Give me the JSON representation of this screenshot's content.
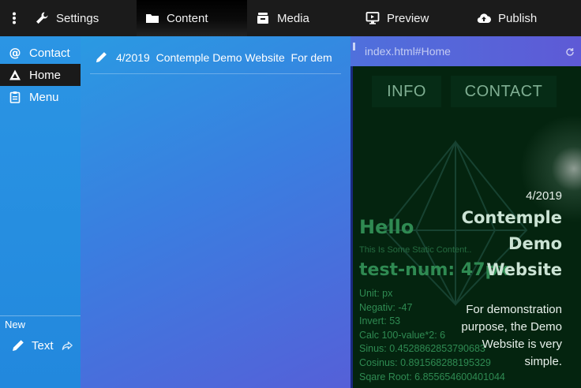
{
  "topbar": {
    "items": [
      {
        "label": "Settings",
        "icon": "wrench-icon"
      },
      {
        "label": "Content",
        "icon": "folder-icon"
      },
      {
        "label": "Media",
        "icon": "media-icon"
      },
      {
        "label": "Preview",
        "icon": "monitor-icon"
      },
      {
        "label": "Publish",
        "icon": "cloud-upload-icon"
      }
    ],
    "active": "Content"
  },
  "sidebar": {
    "items": [
      {
        "label": "Contact",
        "icon": "at-icon"
      },
      {
        "label": "Home",
        "icon": "logo-icon"
      },
      {
        "label": "Menu",
        "icon": "clipboard-icon"
      }
    ],
    "active": "Home",
    "new_section_label": "New",
    "new_item_label": "Text"
  },
  "content_list": {
    "items": [
      {
        "label": "4/2019  Contemple Demo Website  For dem"
      }
    ]
  },
  "preview": {
    "url": "index.html#Home",
    "nav": [
      "INFO",
      "CONTACT"
    ],
    "date": "4/2019",
    "title_lines": [
      "Contemple",
      "Demo",
      "Website"
    ],
    "hello": "Hello",
    "static_text": "This Is Some Static Content..",
    "test_num": "test-num: 47px",
    "stats": [
      "Unit: px",
      "Negativ: -47",
      "Invert: 53",
      "Calc 100-value*2: 6",
      "Sinus: 0.4528862853790683",
      "Cosinus: 0.891568288195329",
      "Sqare Root: 6.855654600401044"
    ],
    "description_lines": [
      "For demonstration",
      "purpose, the Demo",
      "Website is very",
      "simple."
    ]
  },
  "colors": {
    "topbar_bg": "#1b1b1b",
    "accent_blue": "#2a8fe0",
    "preview_bg": "#04240f",
    "preview_green": "#2f8a52"
  }
}
